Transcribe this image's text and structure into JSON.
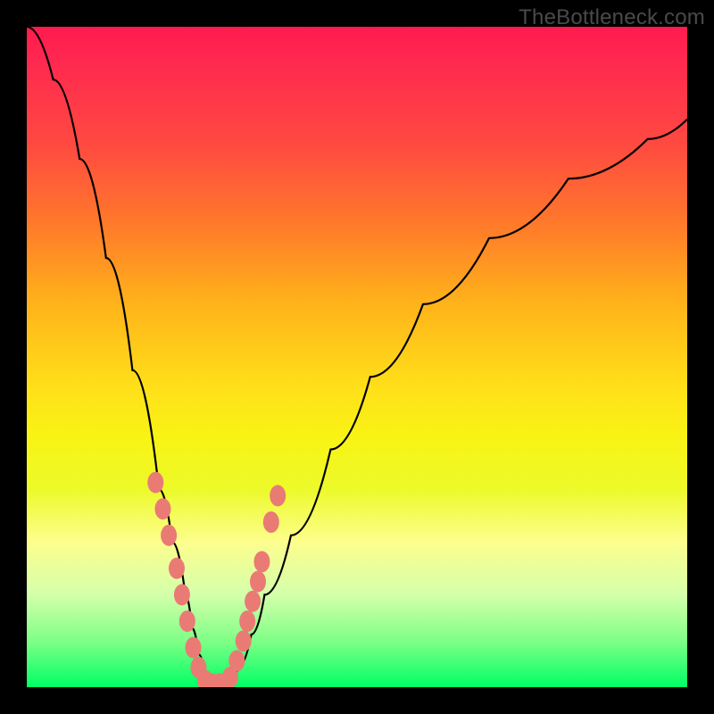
{
  "watermark": "TheBottleneck.com",
  "chart_data": {
    "type": "line",
    "title": "",
    "xlabel": "",
    "ylabel": "",
    "xlim": [
      0,
      100
    ],
    "ylim": [
      0,
      100
    ],
    "grid": false,
    "legend_position": "none",
    "notes": "V-shaped bottleneck curve over red→yellow→green vertical heat gradient (red=high bottleneck, green=optimal). Background colour encodes match quality from top (worst) to bottom (best). Values estimated from pixel positions.",
    "series": [
      {
        "name": "bottleneck-curve",
        "x": [
          0,
          4,
          8,
          12,
          16,
          20,
          22,
          24,
          25,
          26,
          27,
          28,
          29,
          30,
          32,
          34,
          36,
          40,
          46,
          52,
          60,
          70,
          82,
          94,
          100
        ],
        "y": [
          100,
          92,
          80,
          65,
          48,
          30,
          22,
          14,
          9,
          5,
          2,
          0,
          0,
          0,
          3,
          8,
          14,
          23,
          36,
          47,
          58,
          68,
          77,
          83,
          86
        ]
      },
      {
        "name": "highlighted-points",
        "x": [
          19.5,
          20.6,
          21.5,
          22.7,
          23.5,
          24.3,
          25.2,
          26.0,
          27.0,
          28.0,
          29.2,
          30.8,
          31.8,
          32.8,
          33.4,
          34.2,
          35.0,
          35.6,
          37.0,
          38.0
        ],
        "y": [
          31,
          27,
          23,
          18,
          14,
          10,
          6,
          3,
          1,
          0.5,
          0.5,
          1.5,
          4,
          7,
          10,
          13,
          16,
          19,
          25,
          29
        ]
      }
    ],
    "gradient_colors": {
      "top": "#ff1a4d",
      "mid_upper": "#ff7a2a",
      "mid": "#ffe119",
      "mid_lower": "#fdfe8d",
      "bottom": "#00ff66"
    }
  }
}
